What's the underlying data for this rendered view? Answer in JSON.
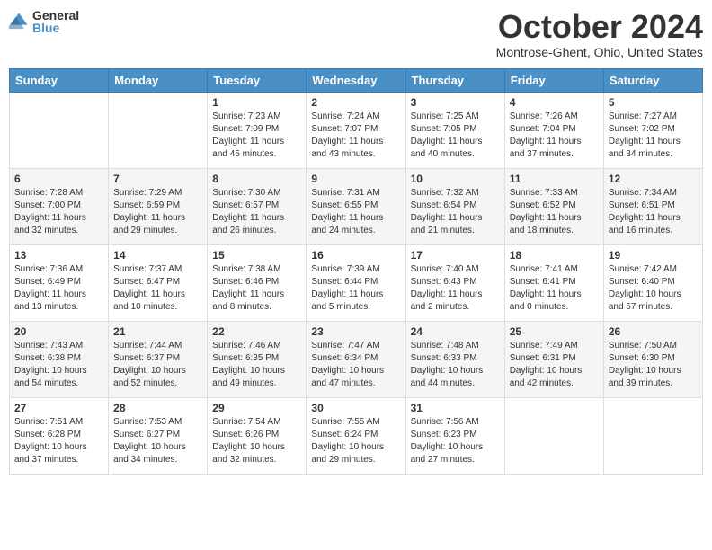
{
  "header": {
    "logo": {
      "general": "General",
      "blue": "Blue"
    },
    "title": "October 2024",
    "location": "Montrose-Ghent, Ohio, United States"
  },
  "days": [
    "Sunday",
    "Monday",
    "Tuesday",
    "Wednesday",
    "Thursday",
    "Friday",
    "Saturday"
  ],
  "weeks": [
    [
      {
        "day": "",
        "content": ""
      },
      {
        "day": "",
        "content": ""
      },
      {
        "day": "1",
        "content": "Sunrise: 7:23 AM\nSunset: 7:09 PM\nDaylight: 11 hours and 45 minutes."
      },
      {
        "day": "2",
        "content": "Sunrise: 7:24 AM\nSunset: 7:07 PM\nDaylight: 11 hours and 43 minutes."
      },
      {
        "day": "3",
        "content": "Sunrise: 7:25 AM\nSunset: 7:05 PM\nDaylight: 11 hours and 40 minutes."
      },
      {
        "day": "4",
        "content": "Sunrise: 7:26 AM\nSunset: 7:04 PM\nDaylight: 11 hours and 37 minutes."
      },
      {
        "day": "5",
        "content": "Sunrise: 7:27 AM\nSunset: 7:02 PM\nDaylight: 11 hours and 34 minutes."
      }
    ],
    [
      {
        "day": "6",
        "content": "Sunrise: 7:28 AM\nSunset: 7:00 PM\nDaylight: 11 hours and 32 minutes."
      },
      {
        "day": "7",
        "content": "Sunrise: 7:29 AM\nSunset: 6:59 PM\nDaylight: 11 hours and 29 minutes."
      },
      {
        "day": "8",
        "content": "Sunrise: 7:30 AM\nSunset: 6:57 PM\nDaylight: 11 hours and 26 minutes."
      },
      {
        "day": "9",
        "content": "Sunrise: 7:31 AM\nSunset: 6:55 PM\nDaylight: 11 hours and 24 minutes."
      },
      {
        "day": "10",
        "content": "Sunrise: 7:32 AM\nSunset: 6:54 PM\nDaylight: 11 hours and 21 minutes."
      },
      {
        "day": "11",
        "content": "Sunrise: 7:33 AM\nSunset: 6:52 PM\nDaylight: 11 hours and 18 minutes."
      },
      {
        "day": "12",
        "content": "Sunrise: 7:34 AM\nSunset: 6:51 PM\nDaylight: 11 hours and 16 minutes."
      }
    ],
    [
      {
        "day": "13",
        "content": "Sunrise: 7:36 AM\nSunset: 6:49 PM\nDaylight: 11 hours and 13 minutes."
      },
      {
        "day": "14",
        "content": "Sunrise: 7:37 AM\nSunset: 6:47 PM\nDaylight: 11 hours and 10 minutes."
      },
      {
        "day": "15",
        "content": "Sunrise: 7:38 AM\nSunset: 6:46 PM\nDaylight: 11 hours and 8 minutes."
      },
      {
        "day": "16",
        "content": "Sunrise: 7:39 AM\nSunset: 6:44 PM\nDaylight: 11 hours and 5 minutes."
      },
      {
        "day": "17",
        "content": "Sunrise: 7:40 AM\nSunset: 6:43 PM\nDaylight: 11 hours and 2 minutes."
      },
      {
        "day": "18",
        "content": "Sunrise: 7:41 AM\nSunset: 6:41 PM\nDaylight: 11 hours and 0 minutes."
      },
      {
        "day": "19",
        "content": "Sunrise: 7:42 AM\nSunset: 6:40 PM\nDaylight: 10 hours and 57 minutes."
      }
    ],
    [
      {
        "day": "20",
        "content": "Sunrise: 7:43 AM\nSunset: 6:38 PM\nDaylight: 10 hours and 54 minutes."
      },
      {
        "day": "21",
        "content": "Sunrise: 7:44 AM\nSunset: 6:37 PM\nDaylight: 10 hours and 52 minutes."
      },
      {
        "day": "22",
        "content": "Sunrise: 7:46 AM\nSunset: 6:35 PM\nDaylight: 10 hours and 49 minutes."
      },
      {
        "day": "23",
        "content": "Sunrise: 7:47 AM\nSunset: 6:34 PM\nDaylight: 10 hours and 47 minutes."
      },
      {
        "day": "24",
        "content": "Sunrise: 7:48 AM\nSunset: 6:33 PM\nDaylight: 10 hours and 44 minutes."
      },
      {
        "day": "25",
        "content": "Sunrise: 7:49 AM\nSunset: 6:31 PM\nDaylight: 10 hours and 42 minutes."
      },
      {
        "day": "26",
        "content": "Sunrise: 7:50 AM\nSunset: 6:30 PM\nDaylight: 10 hours and 39 minutes."
      }
    ],
    [
      {
        "day": "27",
        "content": "Sunrise: 7:51 AM\nSunset: 6:28 PM\nDaylight: 10 hours and 37 minutes."
      },
      {
        "day": "28",
        "content": "Sunrise: 7:53 AM\nSunset: 6:27 PM\nDaylight: 10 hours and 34 minutes."
      },
      {
        "day": "29",
        "content": "Sunrise: 7:54 AM\nSunset: 6:26 PM\nDaylight: 10 hours and 32 minutes."
      },
      {
        "day": "30",
        "content": "Sunrise: 7:55 AM\nSunset: 6:24 PM\nDaylight: 10 hours and 29 minutes."
      },
      {
        "day": "31",
        "content": "Sunrise: 7:56 AM\nSunset: 6:23 PM\nDaylight: 10 hours and 27 minutes."
      },
      {
        "day": "",
        "content": ""
      },
      {
        "day": "",
        "content": ""
      }
    ]
  ]
}
